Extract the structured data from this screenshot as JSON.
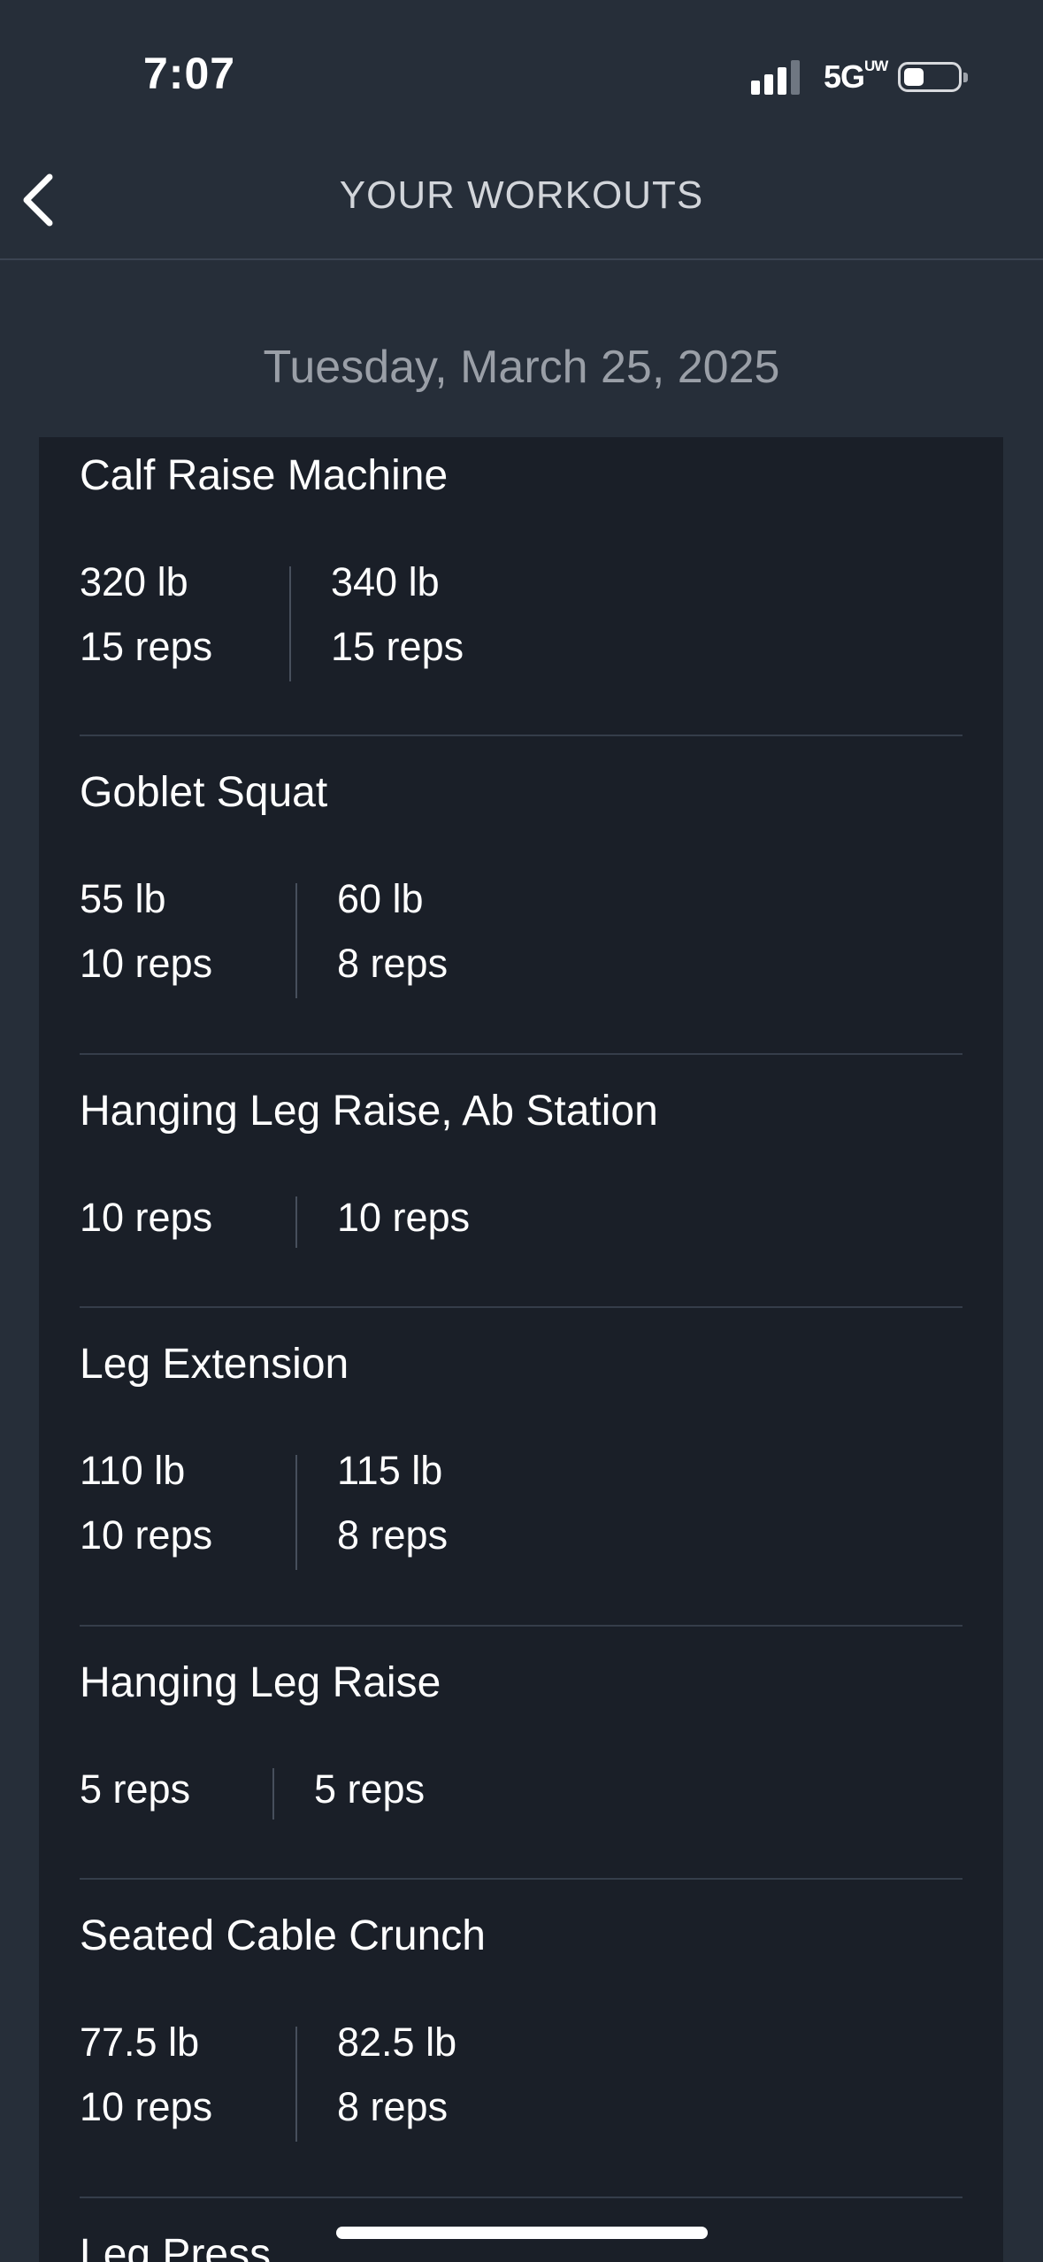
{
  "status_bar": {
    "time": "7:07",
    "network": "5G",
    "network_superscript": "UW",
    "signal_bars_filled": 3,
    "signal_bars_total": 4
  },
  "header": {
    "title": "YOUR WORKOUTS",
    "back_icon": "chevron-left-icon"
  },
  "date": "Tuesday, March 25, 2025",
  "exercises": [
    {
      "name": "Calf Raise Machine",
      "sets": [
        {
          "weight": "320 lb",
          "reps": "15 reps"
        },
        {
          "weight": "340 lb",
          "reps": "15 reps"
        }
      ]
    },
    {
      "name": "Goblet Squat",
      "sets": [
        {
          "weight": "55 lb",
          "reps": "10 reps"
        },
        {
          "weight": "60 lb",
          "reps": "8 reps"
        }
      ]
    },
    {
      "name": "Hanging Leg Raise, Ab Station",
      "sets": [
        {
          "reps": "10 reps"
        },
        {
          "reps": "10 reps"
        }
      ]
    },
    {
      "name": "Leg Extension",
      "sets": [
        {
          "weight": "110 lb",
          "reps": "10 reps"
        },
        {
          "weight": "115 lb",
          "reps": "8 reps"
        }
      ]
    },
    {
      "name": "Hanging Leg Raise",
      "sets": [
        {
          "reps": "5 reps"
        },
        {
          "reps": "5 reps"
        }
      ]
    },
    {
      "name": "Seated Cable Crunch",
      "sets": [
        {
          "weight": "77.5 lb",
          "reps": "10 reps"
        },
        {
          "weight": "82.5 lb",
          "reps": "8 reps"
        }
      ]
    },
    {
      "name": "Leg Press",
      "sets": []
    }
  ]
}
